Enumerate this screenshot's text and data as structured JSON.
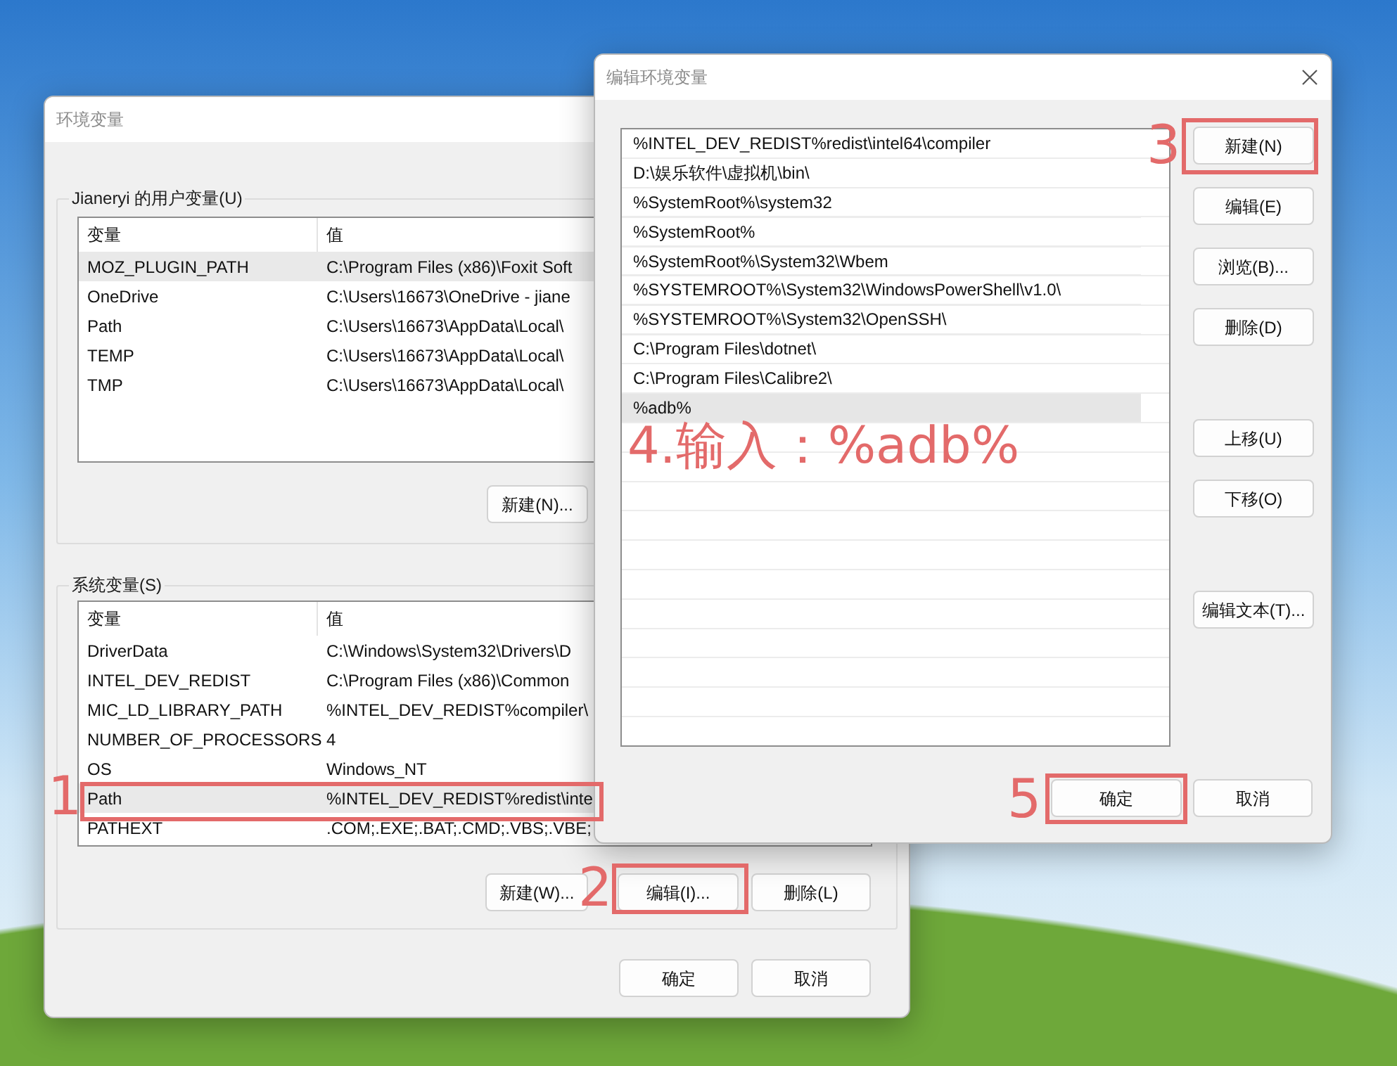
{
  "env_dialog": {
    "title": "环境变量",
    "user_group": {
      "legend": "Jianeryi 的用户变量(U)",
      "columns": [
        "变量",
        "值"
      ],
      "rows": [
        {
          "name": "MOZ_PLUGIN_PATH",
          "value": "C:\\Program Files (x86)\\Foxit Soft",
          "selected": true
        },
        {
          "name": "OneDrive",
          "value": "C:\\Users\\16673\\OneDrive - jiane",
          "selected": false
        },
        {
          "name": "Path",
          "value": "C:\\Users\\16673\\AppData\\Local\\",
          "selected": false
        },
        {
          "name": "TEMP",
          "value": "C:\\Users\\16673\\AppData\\Local\\",
          "selected": false
        },
        {
          "name": "TMP",
          "value": "C:\\Users\\16673\\AppData\\Local\\",
          "selected": false
        }
      ],
      "buttons": [
        "新建(N)..."
      ]
    },
    "system_group": {
      "legend": "系统变量(S)",
      "columns": [
        "变量",
        "值"
      ],
      "rows": [
        {
          "name": "DriverData",
          "value": "C:\\Windows\\System32\\Drivers\\D",
          "selected": false
        },
        {
          "name": "INTEL_DEV_REDIST",
          "value": "C:\\Program Files (x86)\\Common",
          "selected": false
        },
        {
          "name": "MIC_LD_LIBRARY_PATH",
          "value": "%INTEL_DEV_REDIST%compiler\\",
          "selected": false
        },
        {
          "name": "NUMBER_OF_PROCESSORS",
          "value": "4",
          "selected": false
        },
        {
          "name": "OS",
          "value": "Windows_NT",
          "selected": false
        },
        {
          "name": "Path",
          "value": "%INTEL_DEV_REDIST%redist\\inte",
          "selected": true
        },
        {
          "name": "PATHEXT",
          "value": ".COM;.EXE;.BAT;.CMD;.VBS;.VBE;",
          "selected": false
        }
      ],
      "buttons": [
        "新建(W)...",
        "编辑(I)...",
        "删除(L)"
      ]
    },
    "buttons": [
      "确定",
      "取消"
    ]
  },
  "edit_dialog": {
    "title": "编辑环境变量",
    "items": [
      {
        "text": "%INTEL_DEV_REDIST%redist\\intel64\\compiler",
        "selected": false
      },
      {
        "text": "D:\\娱乐软件\\虚拟机\\bin\\",
        "selected": false
      },
      {
        "text": "%SystemRoot%\\system32",
        "selected": false
      },
      {
        "text": "%SystemRoot%",
        "selected": false
      },
      {
        "text": "%SystemRoot%\\System32\\Wbem",
        "selected": false
      },
      {
        "text": "%SYSTEMROOT%\\System32\\WindowsPowerShell\\v1.0\\",
        "selected": false
      },
      {
        "text": "%SYSTEMROOT%\\System32\\OpenSSH\\",
        "selected": false
      },
      {
        "text": "C:\\Program Files\\dotnet\\",
        "selected": false
      },
      {
        "text": "C:\\Program Files\\Calibre2\\",
        "selected": false
      },
      {
        "text": "%adb%",
        "selected": true
      }
    ],
    "side_buttons": [
      "新建(N)",
      "编辑(E)",
      "浏览(B)...",
      "删除(D)",
      "上移(U)",
      "下移(O)",
      "编辑文本(T)..."
    ],
    "buttons": [
      "确定",
      "取消"
    ]
  },
  "annotations": [
    {
      "kind": "step",
      "label": "1"
    },
    {
      "kind": "step",
      "label": "2"
    },
    {
      "kind": "step",
      "label": "3"
    },
    {
      "kind": "note",
      "label": "4.输入：%adb%"
    },
    {
      "kind": "step",
      "label": "5"
    }
  ]
}
